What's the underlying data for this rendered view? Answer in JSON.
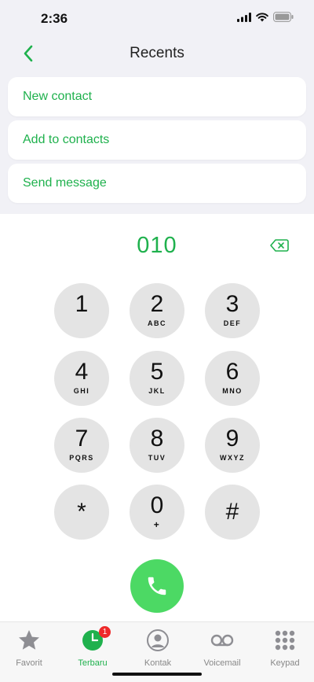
{
  "status_bar": {
    "time": "2:36"
  },
  "nav": {
    "title": "Recents"
  },
  "actions": [
    {
      "label": "New contact"
    },
    {
      "label": "Add to contacts"
    },
    {
      "label": "Send message"
    }
  ],
  "dialer": {
    "number": "010",
    "keys": [
      {
        "digit": "1",
        "letters": ""
      },
      {
        "digit": "2",
        "letters": "ABC"
      },
      {
        "digit": "3",
        "letters": "DEF"
      },
      {
        "digit": "4",
        "letters": "GHI"
      },
      {
        "digit": "5",
        "letters": "JKL"
      },
      {
        "digit": "6",
        "letters": "MNO"
      },
      {
        "digit": "7",
        "letters": "PQRS"
      },
      {
        "digit": "8",
        "letters": "TUV"
      },
      {
        "digit": "9",
        "letters": "WXYZ"
      },
      {
        "digit": "*",
        "letters": ""
      },
      {
        "digit": "0",
        "letters": "+"
      },
      {
        "digit": "#",
        "letters": ""
      }
    ]
  },
  "tabs": [
    {
      "label": "Favorit",
      "icon": "star-icon"
    },
    {
      "label": "Terbaru",
      "icon": "clock-icon",
      "badge": "1",
      "active": true
    },
    {
      "label": "Kontak",
      "icon": "person-icon"
    },
    {
      "label": "Voicemail",
      "icon": "voicemail-icon"
    },
    {
      "label": "Keypad",
      "icon": "keypad-icon"
    }
  ],
  "colors": {
    "accent": "#1fb14d",
    "call": "#4cd964",
    "badge": "#ee2a2a",
    "key": "#e4e4e4"
  }
}
